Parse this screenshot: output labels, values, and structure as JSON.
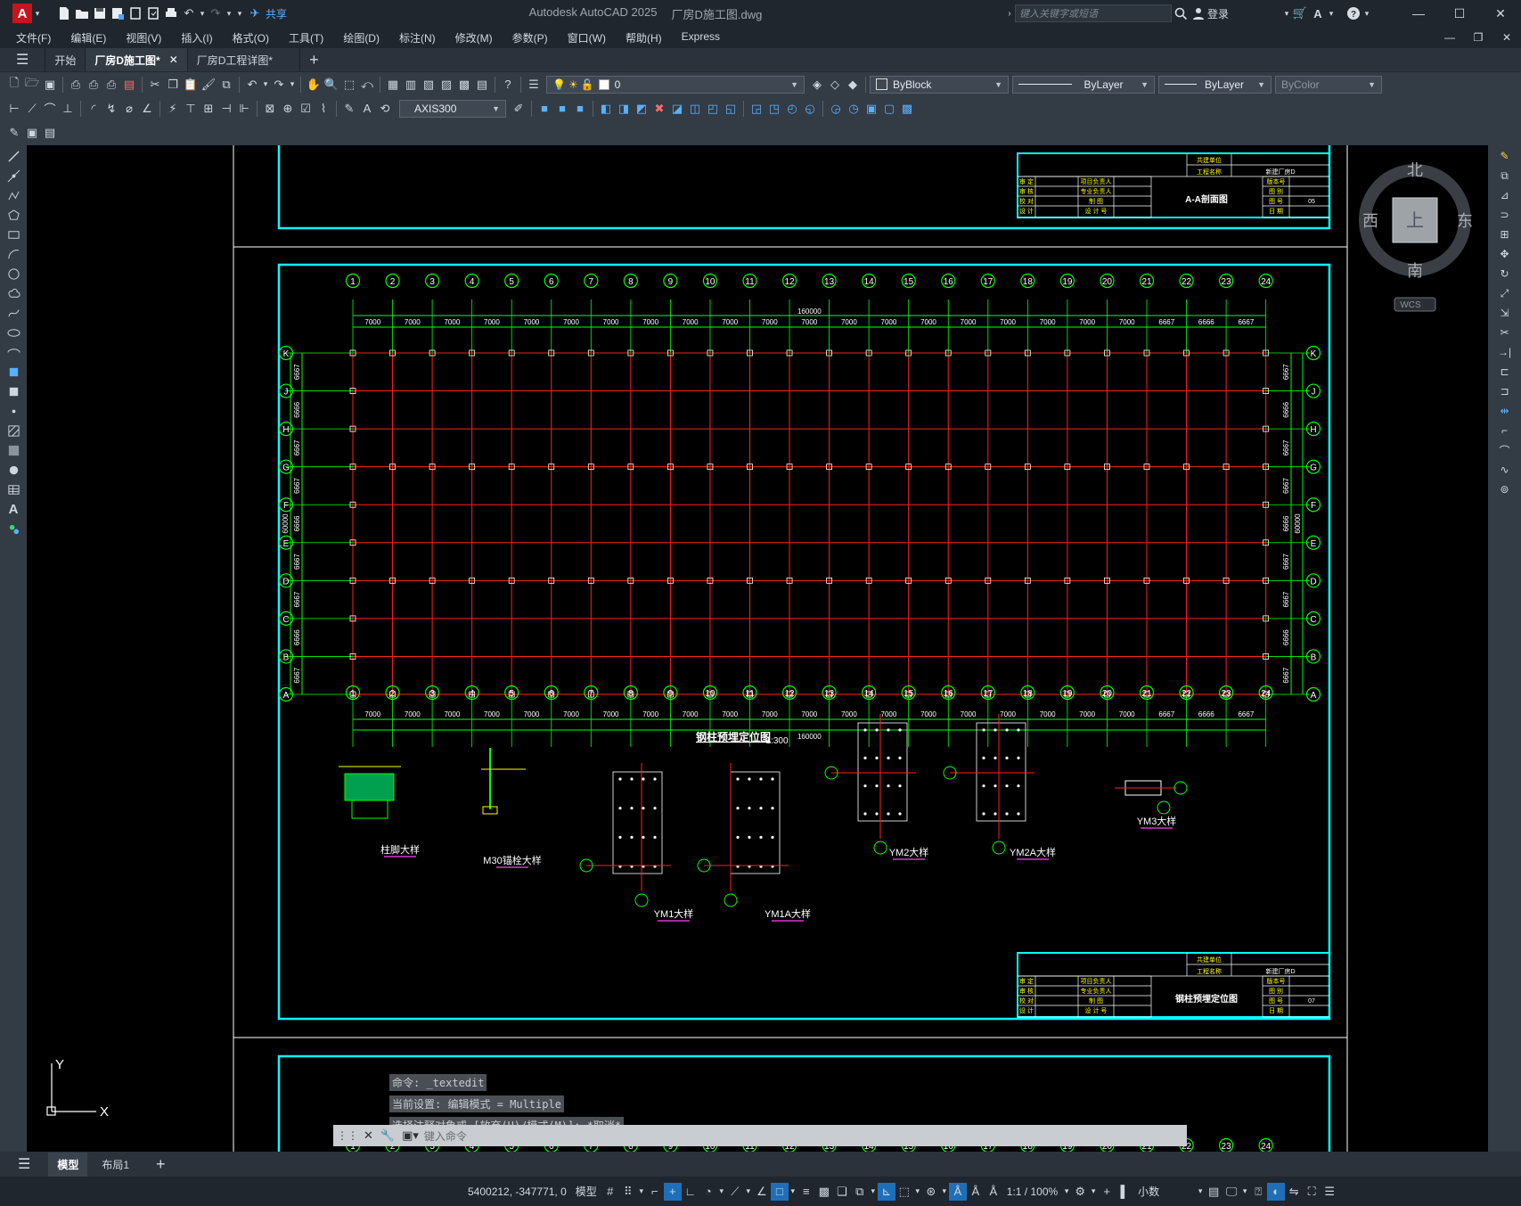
{
  "app": {
    "logo": "A",
    "title": "Autodesk AutoCAD 2025",
    "filename": "厂房D施工图.dwg",
    "search_placeholder": "键入关键字或短语",
    "login": "登录",
    "share": "共享"
  },
  "menu": [
    "文件(F)",
    "编辑(E)",
    "视图(V)",
    "插入(I)",
    "格式(O)",
    "工具(T)",
    "绘图(D)",
    "标注(N)",
    "修改(M)",
    "参数(P)",
    "窗口(W)",
    "帮助(H)",
    "Express"
  ],
  "doc_tabs": [
    {
      "label": "开始",
      "active": false,
      "closable": false
    },
    {
      "label": "厂房D施工图*",
      "active": true,
      "closable": true
    },
    {
      "label": "厂房D工程详图*",
      "active": false,
      "closable": false
    }
  ],
  "toolbar": {
    "layer_value": "0",
    "color": "ByBlock",
    "linetype": "ByLayer",
    "lineweight": "ByLayer",
    "plotstyle": "ByColor",
    "dimstyle": "AXIS300"
  },
  "viewcube": {
    "north": "北",
    "south": "南",
    "east": "东",
    "west": "西",
    "top": "上",
    "wcs": "WCS"
  },
  "ucs": {
    "x": "X",
    "y": "Y"
  },
  "command_history": [
    "命令: _textedit",
    "当前设置: 编辑模式 = Multiple",
    "选择注释对象或 [放弃(U)/模式(M)]: *取消*"
  ],
  "command_placeholder": "键入命令",
  "layout_tabs": [
    {
      "label": "模型",
      "active": true
    },
    {
      "label": "布局1",
      "active": false
    }
  ],
  "status": {
    "coords": "5400212, -347771, 0",
    "model": "模型",
    "scale": "1:1 / 100%",
    "units": "小数"
  },
  "drawing": {
    "top_frame_title": "A-A剖面图",
    "main_title": "钢柱预埋定位图",
    "main_scale": "1:300",
    "project": "新建厂房D",
    "sheet_no_top": "05",
    "sheet_no_main": "07",
    "col_numbers": [
      "1",
      "2",
      "3",
      "4",
      "5",
      "6",
      "7",
      "8",
      "9",
      "10",
      "11",
      "12",
      "13",
      "14",
      "15",
      "16",
      "17",
      "18",
      "19",
      "20",
      "21",
      "22",
      "23",
      "24"
    ],
    "row_letters": [
      "K",
      "J",
      "H",
      "G",
      "F",
      "E",
      "D",
      "C",
      "B",
      "A"
    ],
    "spans": [
      "7000",
      "7000",
      "7000",
      "7000",
      "7000",
      "7000",
      "7000",
      "7000",
      "7000",
      "7000",
      "7000",
      "7000",
      "7000",
      "7000",
      "7000",
      "7000",
      "7000",
      "7000",
      "7000",
      "7000",
      "6667",
      "6666",
      "6667"
    ],
    "total_length": "160000",
    "row_spans": [
      "6667",
      "6666",
      "6667",
      "6667",
      "6666",
      "6667",
      "6667",
      "6666",
      "6667"
    ],
    "total_width": "60000",
    "detail_labels": [
      "柱脚大样",
      "M30锚栓大样",
      "YM1大样",
      "YM1A大样",
      "YM2大样",
      "YM2A大样",
      "YM3大样"
    ],
    "tb_labels": {
      "unit": "共建单位",
      "project_name": "工程名称",
      "approve": "审 定",
      "review": "审 核",
      "check": "校 对",
      "design": "设 计",
      "pm": "项目负责人",
      "spec": "专业负责人",
      "draw": "制 图",
      "designno": "设 计 号",
      "version": "版本号",
      "drawno": "图 别",
      "sheetno": "图 号",
      "date": "日 期"
    }
  }
}
